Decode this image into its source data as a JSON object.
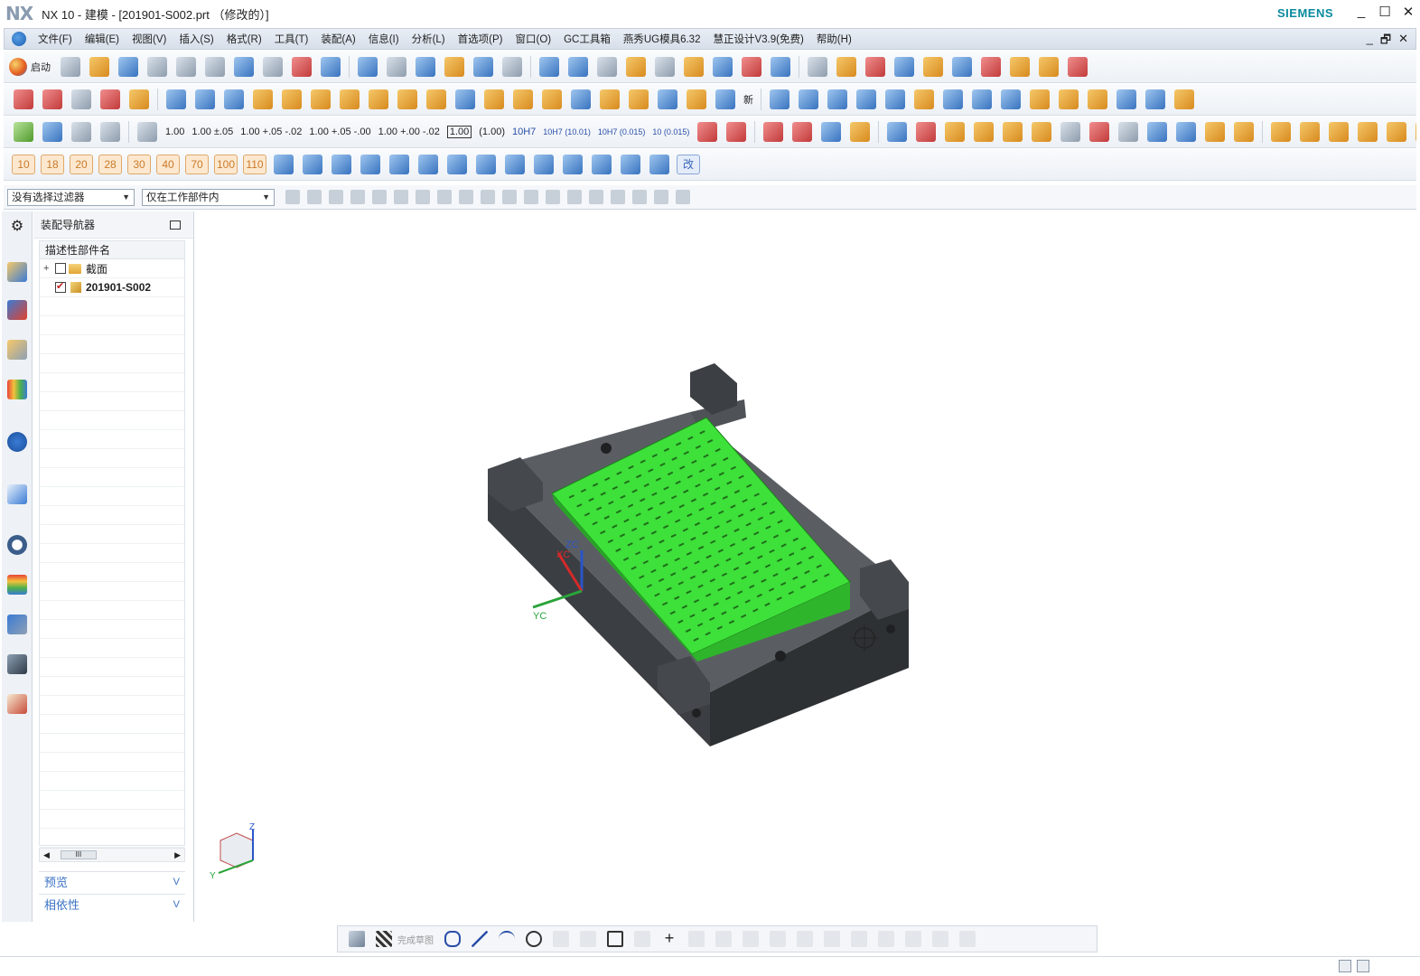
{
  "window": {
    "logo": "NX",
    "title": "NX 10 - 建模 - [201901-S002.prt （修改的）]",
    "brand": "SIEMENS",
    "controls": [
      "_",
      "☐",
      "✕"
    ]
  },
  "menubar": {
    "items": [
      "文件(F)",
      "编辑(E)",
      "视图(V)",
      "插入(S)",
      "格式(R)",
      "工具(T)",
      "装配(A)",
      "信息(I)",
      "分析(L)",
      "首选项(P)",
      "窗口(O)",
      "GC工具箱",
      "燕秀UG模具6.32",
      "慧正设计V3.9(免费)",
      "帮助(H)"
    ],
    "right_controls": [
      "_",
      "🗗",
      "✕"
    ]
  },
  "toolbar": {
    "start_label": "启动",
    "dimensions": [
      "1.00",
      "1.00 ±.05",
      "1.00 +.05 -.02",
      "1.00 +.05 -.00",
      "1.00 +.00 -.02",
      "1.00",
      "(1.00)",
      "10H7",
      "10H7 (10.01)",
      "10H7 (0.015)",
      "10 (0.015)"
    ],
    "new_label": "新",
    "numbers": [
      "10",
      "18",
      "20",
      "28",
      "30",
      "40",
      "70",
      "100",
      "110"
    ],
    "modify_label": "改"
  },
  "filterbar": {
    "selection_filter": "没有选择过滤器",
    "scope_filter": "仅在工作部件内"
  },
  "navigator": {
    "title": "装配导航器",
    "column_header": "描述性部件名",
    "rows": [
      {
        "label": "截面",
        "checked": false,
        "type": "folder",
        "expander": "+"
      },
      {
        "label": "201901-S002",
        "checked": true,
        "type": "part",
        "expander": ""
      }
    ],
    "scroll_thumb": "III",
    "preview_label": "预览",
    "dependency_label": "相依性"
  },
  "viewport": {
    "axis_labels": {
      "zc": "ZC",
      "xc": "XC",
      "yc": "YC"
    },
    "triad_labels": {
      "z": "Z",
      "y": "Y"
    },
    "colors": {
      "part": "#3ee03a",
      "mold": "#4a4d51"
    }
  },
  "bottombar": {
    "finish_sketch_label": "完成草图"
  }
}
